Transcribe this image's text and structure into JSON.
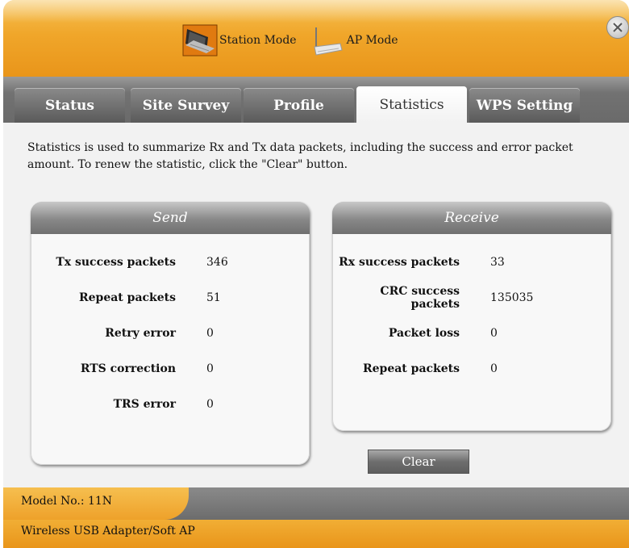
{
  "modes": {
    "station_label": "Station Mode",
    "station_icon": "station-laptop-icon",
    "ap_label": "AP Mode",
    "ap_icon": "router-icon"
  },
  "window": {
    "close_icon": "close-icon"
  },
  "tabs": [
    {
      "label": "Status",
      "active": false
    },
    {
      "label": "Site Survey",
      "active": false
    },
    {
      "label": "Profile",
      "active": false
    },
    {
      "label": "Statistics",
      "active": true
    },
    {
      "label": "WPS Setting",
      "active": false
    }
  ],
  "description": "Statistics is used to summarize Rx and Tx data packets, including the success and error packet amount. To renew the statistic, click the \"Clear\" button.",
  "send": {
    "title": "Send",
    "rows": [
      {
        "label": "Tx success packets",
        "value": "346"
      },
      {
        "label": "Repeat packets",
        "value": "51"
      },
      {
        "label": "Retry error",
        "value": "0"
      },
      {
        "label": "RTS correction",
        "value": "0"
      },
      {
        "label": "TRS error",
        "value": "0"
      }
    ]
  },
  "receive": {
    "title": "Receive",
    "rows": [
      {
        "label": "Rx success packets",
        "value": "33"
      },
      {
        "label": "CRC success packets",
        "value": "135035"
      },
      {
        "label": "Packet loss",
        "value": "0"
      },
      {
        "label": "Repeat packets",
        "value": "0"
      }
    ]
  },
  "clear_label": "Clear",
  "footer": {
    "model": "Model No.: 11N",
    "adapter": "Wireless USB Adapter/Soft AP"
  },
  "colors": {
    "accent_orange": "#f0a62a",
    "band_gray": "#727272"
  }
}
